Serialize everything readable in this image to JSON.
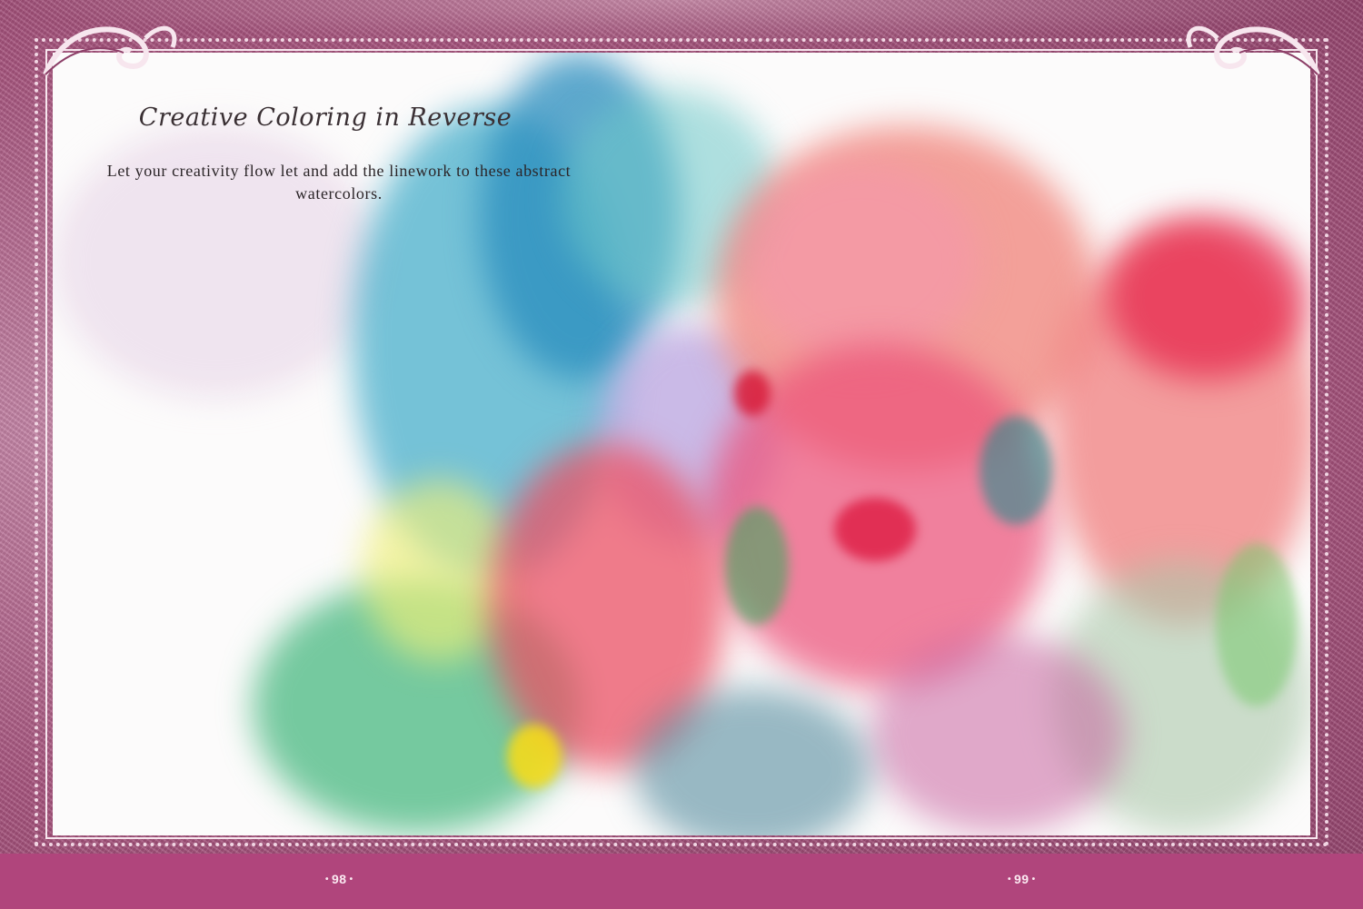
{
  "page": {
    "title": "Creative Coloring in Reverse",
    "instruction": "Let your creativity flow let and add the linework to these abstract watercolors.",
    "page_left": "98",
    "page_right": "99",
    "bullet": "•"
  },
  "colors": {
    "frame": "#b5638f",
    "footer": "#b0457c",
    "paper": "#fcfbfb"
  }
}
